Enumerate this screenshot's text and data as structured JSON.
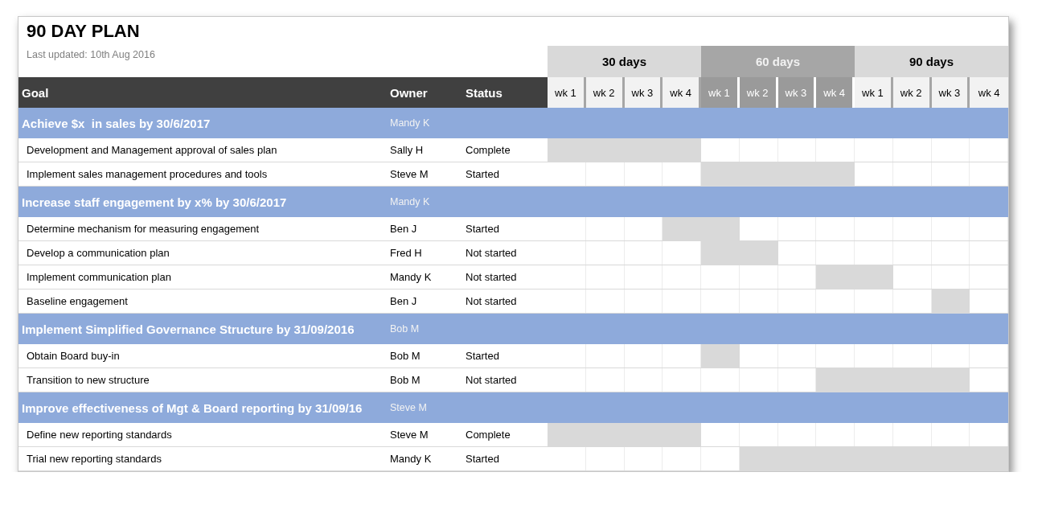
{
  "title": "90 DAY PLAN",
  "last_updated": "Last updated: 10th Aug 2016",
  "columns": [
    "Goal",
    "Owner",
    "Status"
  ],
  "phases": [
    {
      "label": "30 days",
      "shaded": false,
      "weeks": [
        "wk 1",
        "wk 2",
        "wk 3",
        "wk 4"
      ]
    },
    {
      "label": "60 days",
      "shaded": true,
      "weeks": [
        "wk 1",
        "wk 2",
        "wk 3",
        "wk 4"
      ]
    },
    {
      "label": "90 days",
      "shaded": false,
      "weeks": [
        "wk 1",
        "wk 2",
        "wk 3",
        "wk 4"
      ]
    }
  ],
  "goals": [
    {
      "goal": "Achieve $x  in sales by 30/6/2017",
      "owner": "Mandy K",
      "tasks": [
        {
          "task": "Development and Management approval of sales plan",
          "owner": "Sally H",
          "status": "Complete",
          "weeks": [
            true,
            true,
            true,
            true,
            false,
            false,
            false,
            false,
            false,
            false,
            false,
            false
          ]
        },
        {
          "task": "Implement sales management procedures and tools",
          "owner": "Steve M",
          "status": "Started",
          "weeks": [
            false,
            false,
            false,
            false,
            true,
            true,
            true,
            true,
            false,
            false,
            false,
            false
          ]
        }
      ]
    },
    {
      "goal": "Increase staff engagement by x% by 30/6/2017",
      "owner": "Mandy K",
      "tasks": [
        {
          "task": "Determine mechanism for measuring engagement",
          "owner": "Ben J",
          "status": "Started",
          "weeks": [
            false,
            false,
            false,
            true,
            true,
            false,
            false,
            false,
            false,
            false,
            false,
            false
          ]
        },
        {
          "task": "Develop a communication plan",
          "owner": "Fred H",
          "status": "Not started",
          "weeks": [
            false,
            false,
            false,
            false,
            true,
            true,
            false,
            false,
            false,
            false,
            false,
            false
          ]
        },
        {
          "task": "Implement communication plan",
          "owner": "Mandy K",
          "status": "Not started",
          "weeks": [
            false,
            false,
            false,
            false,
            false,
            false,
            false,
            true,
            true,
            false,
            false,
            false
          ]
        },
        {
          "task": "Baseline engagement",
          "owner": "Ben J",
          "status": "Not started",
          "weeks": [
            false,
            false,
            false,
            false,
            false,
            false,
            false,
            false,
            false,
            false,
            true,
            false
          ]
        }
      ]
    },
    {
      "goal": "Implement Simplified Governance Structure by 31/09/2016",
      "owner": "Bob M",
      "tasks": [
        {
          "task": "Obtain Board buy-in",
          "owner": "Bob M",
          "status": "Started",
          "weeks": [
            false,
            false,
            false,
            false,
            true,
            false,
            false,
            false,
            false,
            false,
            false,
            false
          ]
        },
        {
          "task": "Transition to new structure",
          "owner": "Bob M",
          "status": "Not started",
          "weeks": [
            false,
            false,
            false,
            false,
            false,
            false,
            false,
            true,
            true,
            true,
            true,
            false
          ]
        }
      ]
    },
    {
      "goal": "Improve effectiveness of Mgt & Board reporting by 31/09/16",
      "owner": "Steve M",
      "tasks": [
        {
          "task": "Define new reporting standards",
          "owner": "Steve M",
          "status": "Complete",
          "weeks": [
            true,
            true,
            true,
            true,
            false,
            false,
            false,
            false,
            false,
            false,
            false,
            false
          ]
        },
        {
          "task": "Trial new reporting standards",
          "owner": "Mandy K",
          "status": "Started",
          "weeks": [
            false,
            false,
            false,
            false,
            false,
            true,
            true,
            true,
            true,
            true,
            true,
            true
          ]
        }
      ]
    }
  ]
}
